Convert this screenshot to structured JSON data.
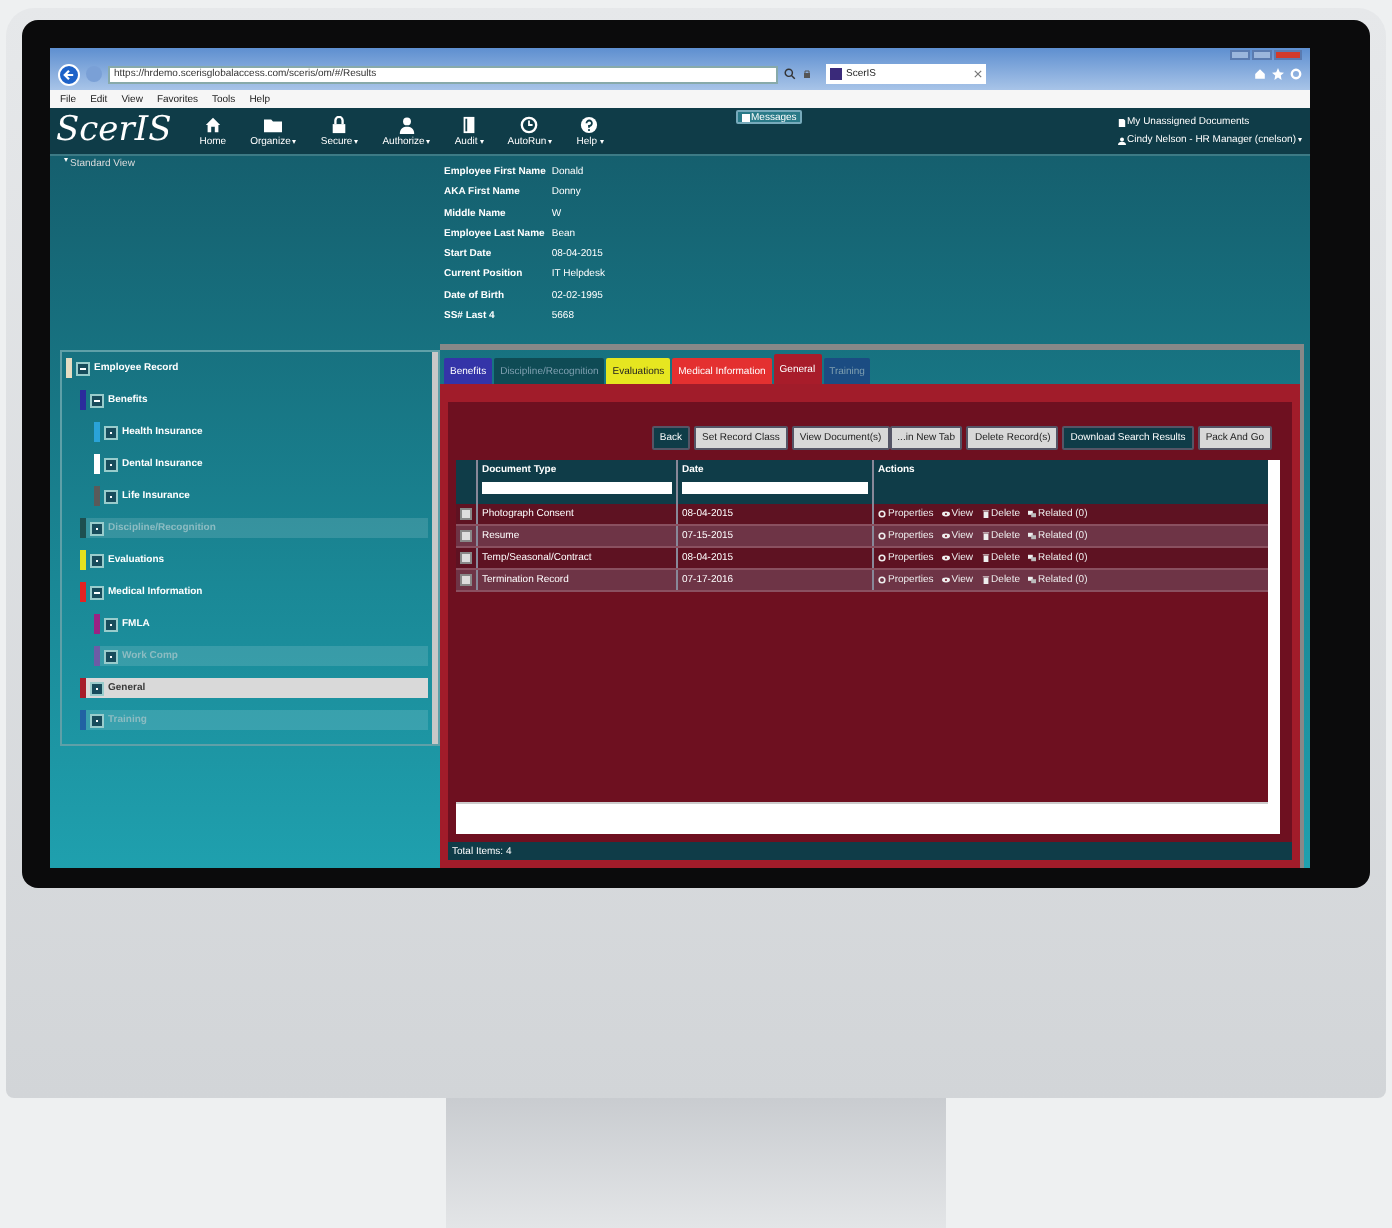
{
  "browser": {
    "url": "https://hrdemo.scerisglobalaccess.com/sceris/om/#/Results",
    "tab_title": "ScerIS",
    "menu": [
      "File",
      "Edit",
      "View",
      "Favorites",
      "Tools",
      "Help"
    ]
  },
  "app": {
    "logo": "ScerIS",
    "nav": [
      {
        "label": "Home",
        "dropdown": false
      },
      {
        "label": "Organize",
        "dropdown": true
      },
      {
        "label": "Secure",
        "dropdown": true
      },
      {
        "label": "Authorize",
        "dropdown": true
      },
      {
        "label": "Audit",
        "dropdown": true
      },
      {
        "label": "AutoRun",
        "dropdown": true
      },
      {
        "label": "Help",
        "dropdown": true
      }
    ],
    "messages": "Messages",
    "user_links": [
      {
        "label": "My Unassigned Documents",
        "dropdown": false
      },
      {
        "label": "Cindy Nelson - HR Manager (cnelson)",
        "dropdown": true
      }
    ]
  },
  "view_toggle": "Standard View",
  "employee": [
    {
      "label": "Employee First Name",
      "value": "Donald"
    },
    {
      "label": "AKA First Name",
      "value": "Donny"
    },
    {
      "label": "Middle Name",
      "value": "W"
    },
    {
      "label": "Employee Last Name",
      "value": "Bean"
    },
    {
      "label": "Start Date",
      "value": "08-04-2015"
    },
    {
      "label": "Current Position",
      "value": "IT Helpdesk"
    },
    {
      "label": "Date of Birth",
      "value": "02-02-1995"
    },
    {
      "label": "SS# Last 4",
      "value": "5668"
    }
  ],
  "tree": [
    {
      "label": "Employee Record",
      "color": "#e6dcc2",
      "expanded": true,
      "disabled": false,
      "selected": false,
      "children": [
        {
          "label": "Benefits",
          "color": "#2b2b9c",
          "expanded": true,
          "disabled": false,
          "selected": false,
          "children": [
            {
              "label": "Health Insurance",
              "color": "#2aa3d8",
              "disabled": false,
              "selected": false
            },
            {
              "label": "Dental Insurance",
              "color": "#ffffff",
              "disabled": false,
              "selected": false
            },
            {
              "label": "Life Insurance",
              "color": "#5a5a5a",
              "disabled": false,
              "selected": false
            }
          ]
        },
        {
          "label": "Discipline/Recognition",
          "color": "#1d4f50",
          "disabled": true,
          "selected": false
        },
        {
          "label": "Evaluations",
          "color": "#e4e21e",
          "disabled": false,
          "selected": false
        },
        {
          "label": "Medical Information",
          "color": "#e42222",
          "expanded": true,
          "disabled": false,
          "selected": false,
          "children": [
            {
              "label": "FMLA",
              "color": "#9a2283",
              "disabled": false,
              "selected": false
            },
            {
              "label": "Work Comp",
              "color": "#6c5ca6",
              "disabled": true,
              "selected": false
            }
          ]
        },
        {
          "label": "General",
          "color": "#a81c2a",
          "disabled": false,
          "selected": true
        },
        {
          "label": "Training",
          "color": "#2162a3",
          "disabled": true,
          "selected": false
        }
      ]
    }
  ],
  "tabs": [
    {
      "label": "Benefits",
      "color": "#3434a8",
      "disabled": false,
      "selected": false
    },
    {
      "label": "Discipline/Recognition",
      "color": "#0f4b55",
      "disabled": true,
      "selected": false
    },
    {
      "label": "Evaluations",
      "color": "#e6e620",
      "disabled": false,
      "selected": false
    },
    {
      "label": "Medical Information",
      "color": "#e43030",
      "disabled": false,
      "selected": false
    },
    {
      "label": "General",
      "color": "#a81c2a",
      "disabled": false,
      "selected": true
    },
    {
      "label": "Training",
      "color": "#1b4c82",
      "disabled": true,
      "selected": false
    }
  ],
  "buttons": [
    {
      "label": "Back",
      "kind": "dark",
      "joined": false
    },
    {
      "label": "Set Record Class",
      "kind": "light",
      "joined": false
    },
    {
      "label": "View Document(s)",
      "kind": "light",
      "joined": false
    },
    {
      "label": "...in New Tab",
      "kind": "light",
      "joined": true
    },
    {
      "label": "Delete Record(s)",
      "kind": "light",
      "joined": false
    },
    {
      "label": "Download Search Results",
      "kind": "dark",
      "joined": false
    },
    {
      "label": "Pack And Go",
      "kind": "light",
      "joined": false
    }
  ],
  "table": {
    "columns": [
      {
        "title": "Document Type",
        "filter": true
      },
      {
        "title": "Date",
        "filter": true
      },
      {
        "title": "Actions",
        "filter": false
      }
    ],
    "rows": [
      {
        "document_type": "Photograph Consent",
        "date": "08-04-2015",
        "actions": [
          "Properties",
          "View",
          "Delete",
          "Related (0)"
        ]
      },
      {
        "document_type": "Resume",
        "date": "07-15-2015",
        "actions": [
          "Properties",
          "View",
          "Delete",
          "Related (0)"
        ]
      },
      {
        "document_type": "Temp/Seasonal/Contract",
        "date": "08-04-2015",
        "actions": [
          "Properties",
          "View",
          "Delete",
          "Related (0)"
        ]
      },
      {
        "document_type": "Termination Record",
        "date": "07-17-2016",
        "actions": [
          "Properties",
          "View",
          "Delete",
          "Related (0)"
        ]
      }
    ]
  },
  "total_items": "Total Items: 4"
}
